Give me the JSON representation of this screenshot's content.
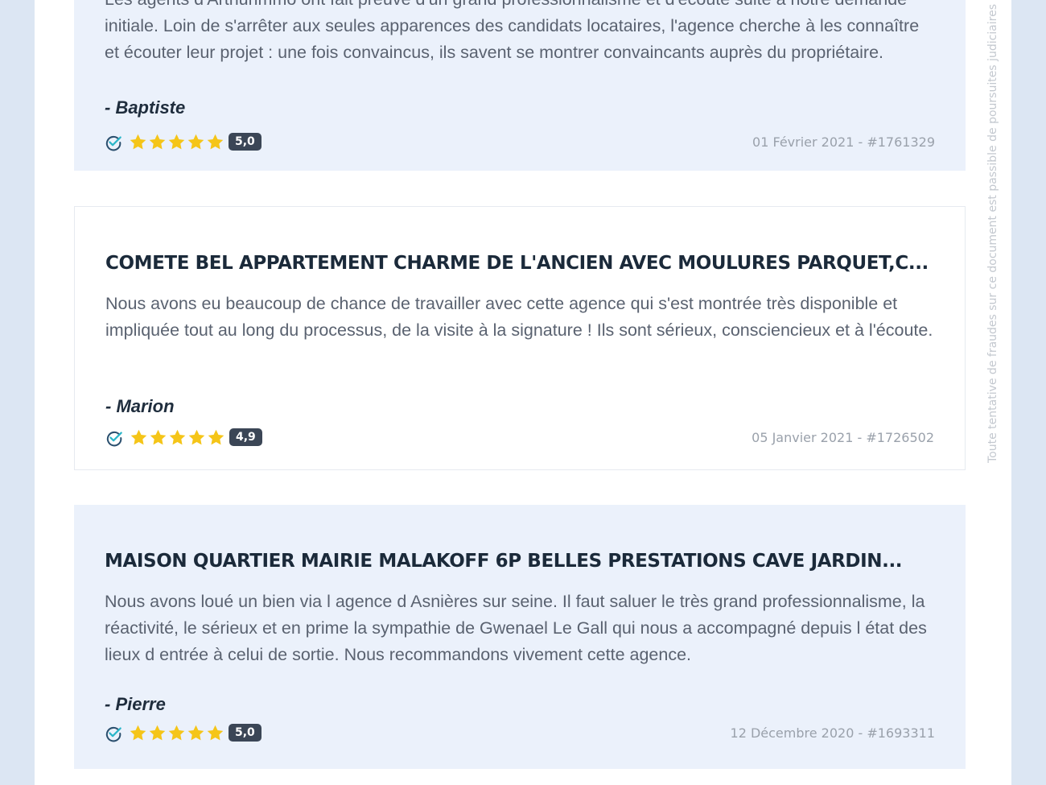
{
  "reviews": [
    {
      "title": "",
      "text": "Les agents d'Arthurimmo ont fait preuve d'un grand professionnalisme et d'écoute suite à notre demande initiale. Loin de s'arrêter aux seules apparences des candidats locataires, l'agence cherche à les connaître et écouter leur projet : une fois convaincus, ils savent se montrer convaincants auprès du propriétaire.",
      "author": "- Baptiste",
      "score": "5,0",
      "meta": "01 Février 2021 - #1761329"
    },
    {
      "title": "COMETE BEL APPARTEMENT CHARME DE L'ANCIEN AVEC MOULURES PARQUET,C...",
      "text": "Nous avons eu beaucoup de chance de travailler avec cette agence qui s'est montrée très disponible et impliquée tout au long du processus, de la visite à la signature ! Ils sont sérieux, consciencieux et à l'écoute.",
      "author": "- Marion",
      "score": "4,9",
      "meta": "05 Janvier 2021 - #1726502"
    },
    {
      "title": "MAISON QUARTIER MAIRIE MALAKOFF 6P BELLES PRESTATIONS CAVE JARDIN...",
      "text": "Nous avons loué un bien via l agence d Asnières sur seine. Il faut saluer le très grand professionnalisme, la réactivité, le sérieux et en prime la sympathie de Gwenael Le Gall qui nous a accompagné depuis l état des lieux d entrée à celui de sortie. Nous recommandons vivement cette agence.",
      "author": "- Pierre",
      "score": "5,0",
      "meta": "12 Décembre 2020 - #1693311"
    }
  ],
  "watermark": "Toute tentative de fraudes sur ce document est passible de poursuites judiciaires",
  "colors": {
    "star": "#f5c518",
    "check": "#2a4f6e",
    "check_accent": "#2bb6c9"
  },
  "icons": {
    "verified": "verified-check-icon",
    "star": "star-icon"
  }
}
